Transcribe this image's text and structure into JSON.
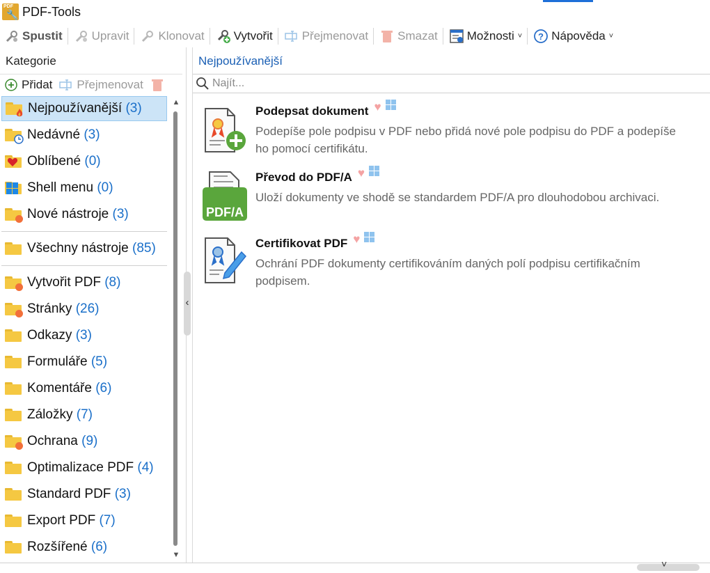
{
  "window": {
    "title": "PDF-Tools",
    "icon_label": "PDF"
  },
  "toolbar": {
    "run": "Spustit",
    "edit": "Upravit",
    "clone": "Klonovat",
    "create": "Vytvořit",
    "rename": "Přejmenovat",
    "delete": "Smazat",
    "options": "Možnosti",
    "help": "Nápověda"
  },
  "left_pane": {
    "title": "Kategorie",
    "add": "Přidat",
    "rename": "Přejmenovat",
    "categories": [
      {
        "name": "Nejpoužívanější",
        "count": "(3)",
        "icon": "flame-folder-icon",
        "selected": true
      },
      {
        "name": "Nedávné",
        "count": "(3)",
        "icon": "clock-folder-icon"
      },
      {
        "name": "Oblíbené",
        "count": "(0)",
        "icon": "heart-folder-icon"
      },
      {
        "name": "Shell menu",
        "count": "(0)",
        "icon": "windows-folder-icon"
      },
      {
        "name": "Nové nástroje",
        "count": "(3)",
        "icon": "folder-icon"
      },
      {
        "name": "Všechny nástroje",
        "count": "(85)",
        "icon": "folder-icon"
      },
      {
        "name": "Vytvořit PDF",
        "count": "(8)",
        "icon": "folder-icon"
      },
      {
        "name": "Stránky",
        "count": "(26)",
        "icon": "folder-icon"
      },
      {
        "name": "Odkazy",
        "count": "(3)",
        "icon": "folder-icon"
      },
      {
        "name": "Formuláře",
        "count": "(5)",
        "icon": "folder-icon"
      },
      {
        "name": "Komentáře",
        "count": "(6)",
        "icon": "folder-icon"
      },
      {
        "name": "Záložky",
        "count": "(7)",
        "icon": "folder-icon"
      },
      {
        "name": "Ochrana",
        "count": "(9)",
        "icon": "folder-icon"
      },
      {
        "name": "Optimalizace PDF",
        "count": "(4)",
        "icon": "folder-icon"
      },
      {
        "name": "Standard PDF",
        "count": "(3)",
        "icon": "folder-icon"
      },
      {
        "name": "Export PDF",
        "count": "(7)",
        "icon": "folder-icon"
      },
      {
        "name": "Rozšířené",
        "count": "(6)",
        "icon": "folder-icon"
      }
    ]
  },
  "right_pane": {
    "title": "Nejpoužívanější",
    "search_placeholder": "Najít...",
    "tools": [
      {
        "name": "Podepsat dokument",
        "description": "Podepíše pole podpisu v PDF nebo přidá nové pole podpisu do PDF a podepíše ho pomocí certifikátu."
      },
      {
        "name": "Převod do PDF/A",
        "icon_label": "PDF/A",
        "description": "Uloží dokumenty ve shodě se standardem PDF/A pro dlouhodobou archivaci."
      },
      {
        "name": "Certifikovat PDF",
        "description": "Ochrání PDF dokumenty certifikováním daných polí podpisu certifikačním podpisem."
      }
    ]
  },
  "colors": {
    "folder": "#f5c842",
    "selected_bg": "#cce4f7",
    "count_text": "#1a6fc9",
    "accent_blue": "#1e6fd8",
    "badge_orange": "#f2703a",
    "pdfa_green": "#5aa63c",
    "heart": "#f4a3a3"
  }
}
